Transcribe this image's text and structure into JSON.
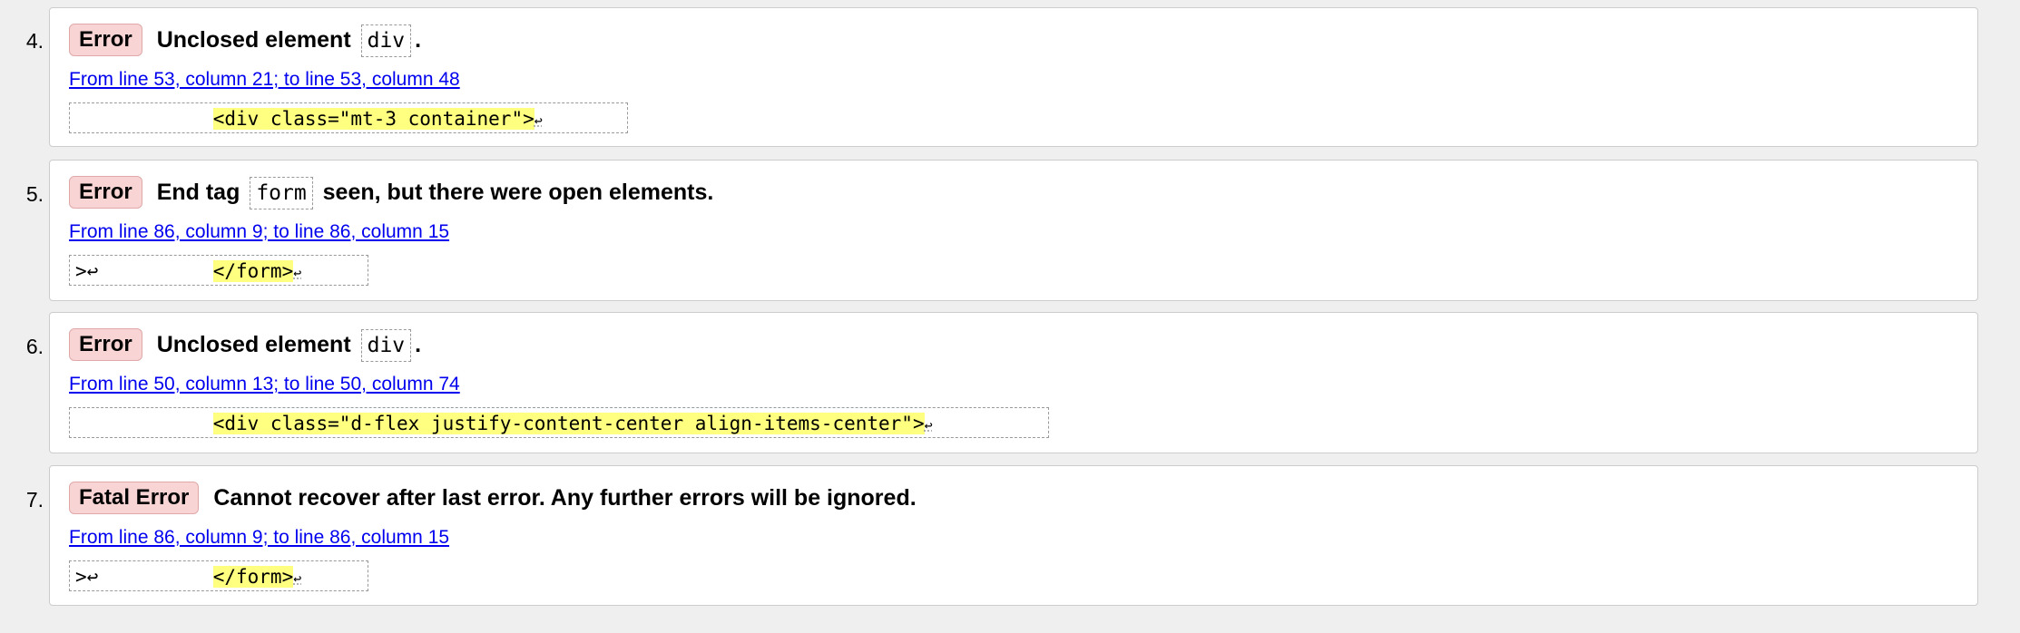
{
  "items": [
    {
      "number": "4.",
      "type": "Error",
      "message_before": "Unclosed element",
      "code": "div",
      "message_after": ".",
      "location": "From line 53, column 21; to line 53, column 48",
      "extract_prefix": "            ",
      "extract_highlight": "<div class=\"mt-3 container\">",
      "extract_suffix": "↩"
    },
    {
      "number": "5.",
      "type": "Error",
      "message_before": "End tag",
      "code": "form",
      "message_after": "seen, but there were open elements.",
      "location": "From line 86, column 9; to line 86, column 15",
      "extract_prefix": ">↩          ",
      "extract_highlight": "</form>",
      "extract_suffix": "↩"
    },
    {
      "number": "6.",
      "type": "Error",
      "message_before": "Unclosed element",
      "code": "div",
      "message_after": ".",
      "location": "From line 50, column 13; to line 50, column 74",
      "extract_prefix": "            ",
      "extract_highlight": "<div class=\"d-flex justify-content-center align-items-center\">",
      "extract_suffix": "↩"
    },
    {
      "number": "7.",
      "type": "Fatal Error",
      "message_before": "Cannot recover after last error. Any further errors will be ignored.",
      "code": "",
      "message_after": "",
      "location": "From line 86, column 9; to line 86, column 15",
      "extract_prefix": ">↩          ",
      "extract_highlight": "</form>",
      "extract_suffix": "↩"
    }
  ],
  "colors": {
    "badge_background": "#f8d4d4",
    "link": "#0000ee",
    "highlight": "#ffff80"
  }
}
